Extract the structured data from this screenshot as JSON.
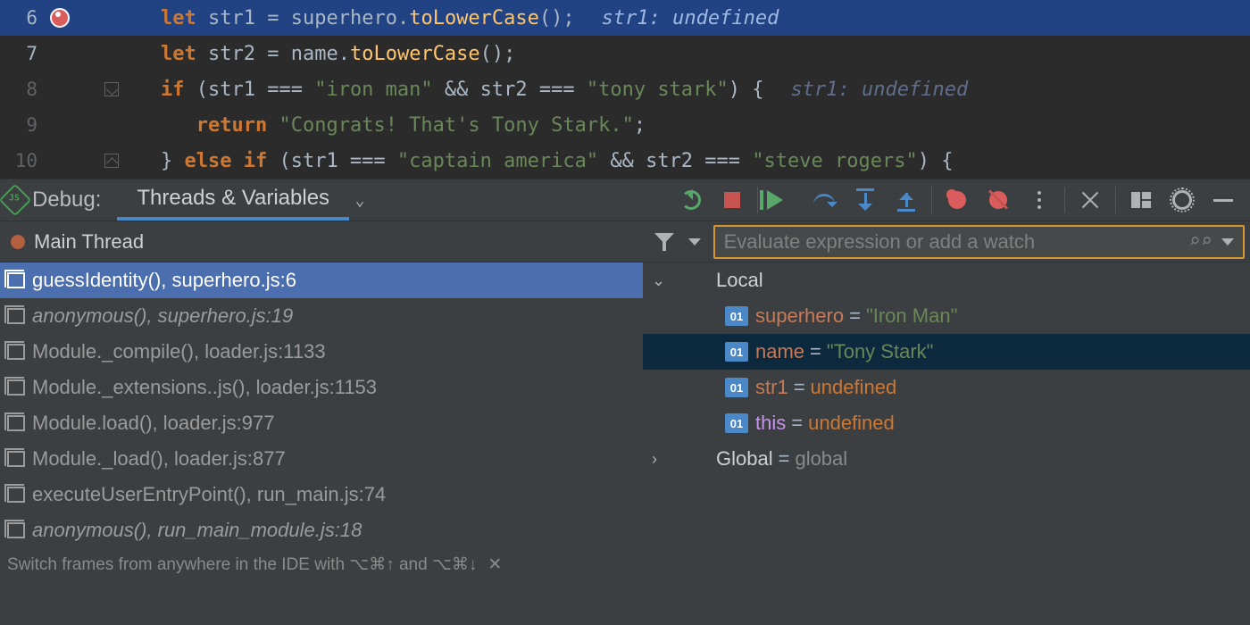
{
  "editor": {
    "lines": [
      {
        "num": "6",
        "active": true,
        "hint": "str1: undefined"
      },
      {
        "num": "7",
        "active": true
      },
      {
        "num": "8",
        "active": false,
        "hint": "str1: undefined"
      },
      {
        "num": "9",
        "active": false
      },
      {
        "num": "10",
        "active": false
      }
    ],
    "code": {
      "l6": {
        "kw": "let",
        "v": " str1 ",
        "eq": "= ",
        "obj": "superhero",
        "dot": ".",
        "call": "toLowerCase",
        "tail": "();"
      },
      "l7": {
        "kw": "let",
        "v": " str2 ",
        "eq": "= ",
        "obj": "name",
        "dot": ".",
        "call": "toLowerCase",
        "tail": "();"
      },
      "l8": {
        "kw": "if",
        "open": " (str1 === ",
        "s1": "\"iron man\"",
        "mid": " && str2 === ",
        "s2": "\"tony stark\"",
        "close": ") {"
      },
      "l9": {
        "kw": "return",
        "sp": " ",
        "s": "\"Congrats! That's Tony Stark.\"",
        "tail": ";"
      },
      "l10": {
        "pre": "} ",
        "kw": "else if",
        "open": " (str1 === ",
        "s1": "\"captain america\"",
        "mid": " && str2 === ",
        "s2": "\"steve rogers\"",
        "close": ") {"
      }
    }
  },
  "debug": {
    "label": "Debug:",
    "tab": "Threads & Variables",
    "thread": "Main Thread",
    "eval_placeholder": "Evaluate expression or add a watch",
    "tip": "Switch frames from anywhere in the IDE with ⌥⌘↑ and ⌥⌘↓",
    "frames": [
      {
        "label": "guessIdentity(), superhero.js:6",
        "sel": true,
        "ital": false
      },
      {
        "label": "anonymous(), superhero.js:19",
        "sel": false,
        "ital": true
      },
      {
        "label": "Module._compile(), loader.js:1133",
        "sel": false,
        "ital": false
      },
      {
        "label": "Module._extensions..js(), loader.js:1153",
        "sel": false,
        "ital": false
      },
      {
        "label": "Module.load(), loader.js:977",
        "sel": false,
        "ital": false
      },
      {
        "label": "Module._load(), loader.js:877",
        "sel": false,
        "ital": false
      },
      {
        "label": "executeUserEntryPoint(), run_main.js:74",
        "sel": false,
        "ital": false
      },
      {
        "label": "anonymous(), run_main_module.js:18",
        "sel": false,
        "ital": true
      }
    ],
    "scopes": {
      "local_label": "Local",
      "global_label": "Global",
      "global_value": "global",
      "vars": [
        {
          "name": "superhero",
          "value": "\"Iron Man\"",
          "kind": "str",
          "badge": "01",
          "sel": false
        },
        {
          "name": "name",
          "value": "\"Tony Stark\"",
          "kind": "str",
          "badge": "01",
          "sel": true
        },
        {
          "name": "str1",
          "value": "undefined",
          "kind": "kw",
          "badge": "01",
          "sel": false
        },
        {
          "name": "this",
          "value": "undefined",
          "kind": "kw",
          "badge": "01",
          "sel": false,
          "purple": true
        }
      ]
    }
  }
}
